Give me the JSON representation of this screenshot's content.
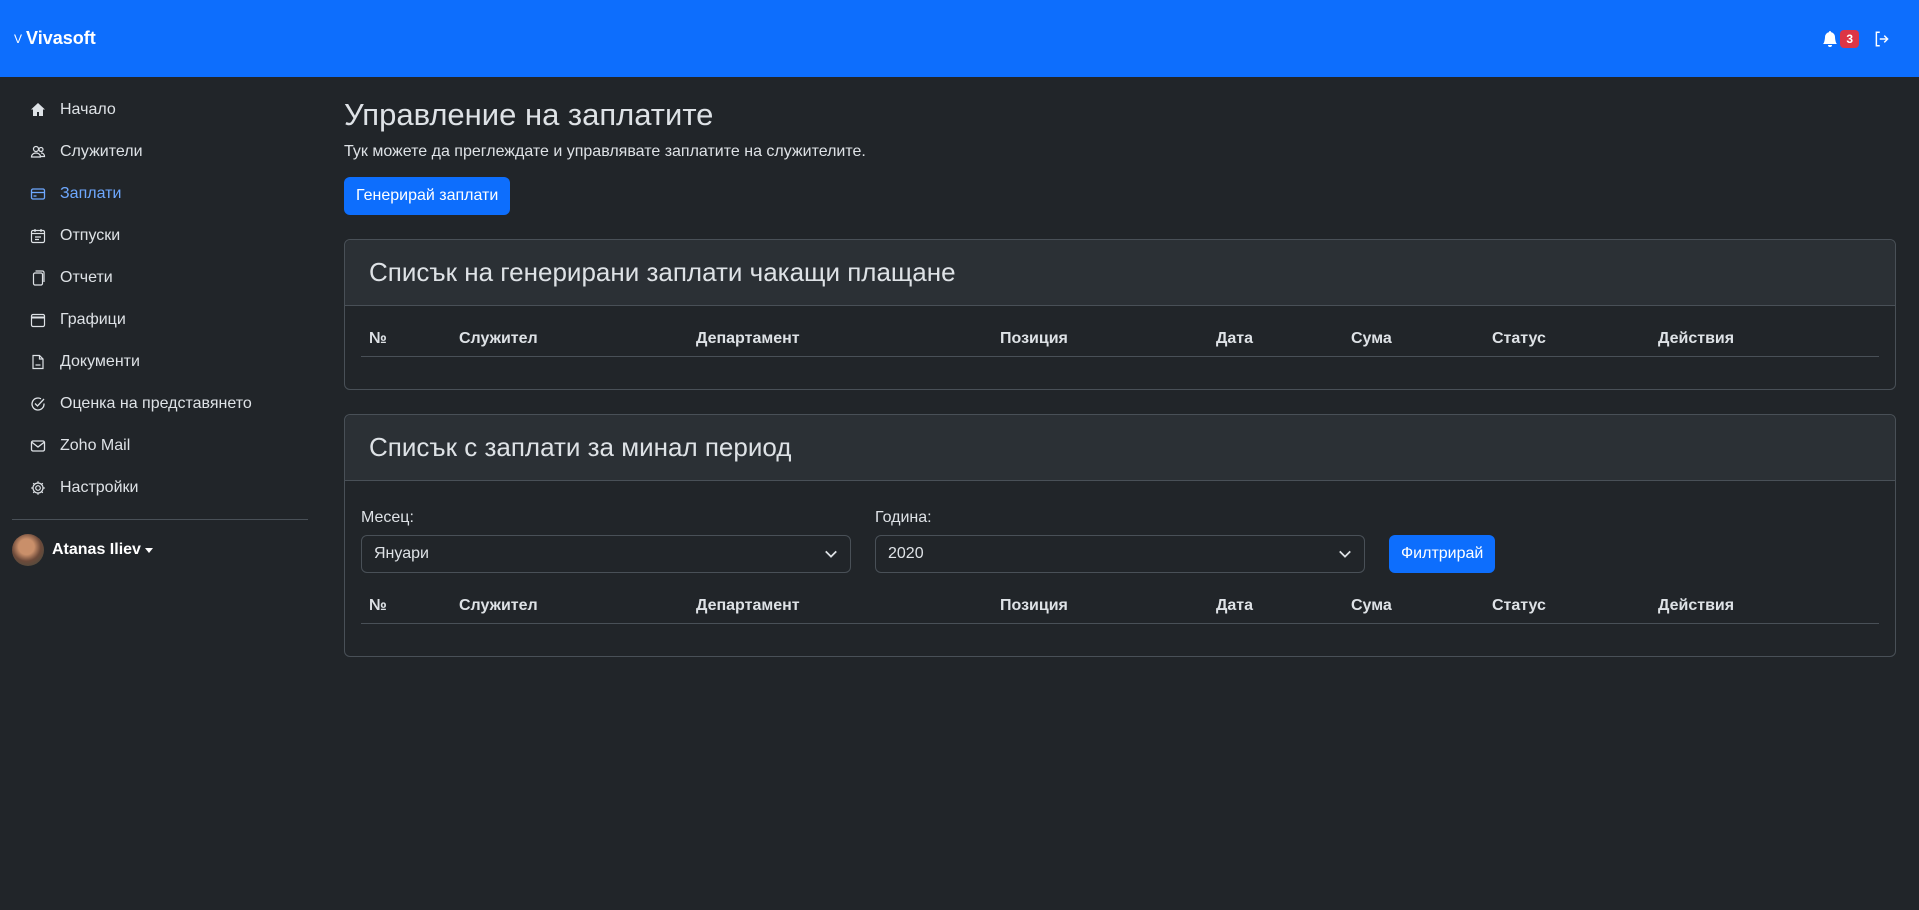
{
  "brand": {
    "mark": "V",
    "name": "Vivasoft"
  },
  "notifications": {
    "count": "3"
  },
  "sidebar": {
    "items": [
      {
        "label": "Начало",
        "icon": "home-icon"
      },
      {
        "label": "Служители",
        "icon": "users-icon"
      },
      {
        "label": "Заплати",
        "icon": "card-icon",
        "active": true
      },
      {
        "label": "Отпуски",
        "icon": "calendar-icon"
      },
      {
        "label": "Отчети",
        "icon": "report-icon"
      },
      {
        "label": "Графици",
        "icon": "schedule-icon"
      },
      {
        "label": "Документи",
        "icon": "document-icon"
      },
      {
        "label": "Оценка на представянето",
        "icon": "check-circle-icon"
      },
      {
        "label": "Zoho Mail",
        "icon": "mail-icon"
      },
      {
        "label": "Настройки",
        "icon": "gear-icon"
      }
    ],
    "user": {
      "name": "Atanas Iliev"
    }
  },
  "page": {
    "title": "Управление на заплатите",
    "subtitle": "Тук можете да преглеждате и управлявате заплатите на служителите.",
    "generate_button": "Генерирай заплати"
  },
  "pending_card": {
    "title": "Списък на генерирани заплати чакащи плащане",
    "columns": [
      "№",
      "Служител",
      "Департамент",
      "Позиция",
      "Дата",
      "Сума",
      "Статус",
      "Действия"
    ]
  },
  "past_card": {
    "title": "Списък с заплати за минал период",
    "month_label": "Месец:",
    "month_value": "Януари",
    "year_label": "Година:",
    "year_value": "2020",
    "filter_button": "Филтрирай",
    "columns": [
      "№",
      "Служител",
      "Департамент",
      "Позиция",
      "Дата",
      "Сума",
      "Статус",
      "Действия"
    ]
  },
  "colors": {
    "accent": "#0d6efd",
    "background": "#212529",
    "badge": "#dc3545",
    "active_link": "#6ea8fe"
  }
}
